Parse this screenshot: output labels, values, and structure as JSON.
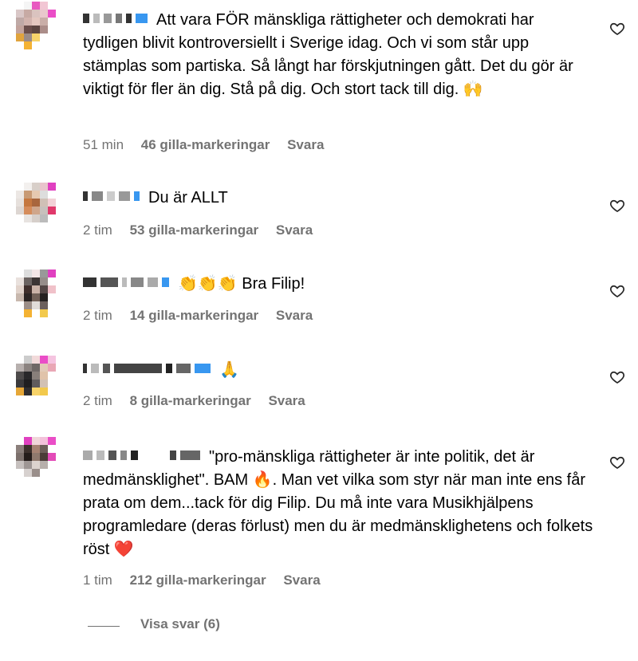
{
  "comments": [
    {
      "text": "Att vara FÖR mänskliga rättigheter och demokrati har tydligen blivit kontroversiellt i Sverige idag. Och vi som står upp stämplas som partiska. Så långt har förskjutningen gått. Det du gör är viktigt för fler än dig. Stå på dig. Och stort tack till dig. 🙌",
      "time": "51 min",
      "likes": "46 gilla-markeringar",
      "reply": "Svara"
    },
    {
      "text": "Du är ALLT",
      "time": "2 tim",
      "likes": "53 gilla-markeringar",
      "reply": "Svara"
    },
    {
      "text": "👏👏👏 Bra Filip!",
      "time": "2 tim",
      "likes": "14 gilla-markeringar",
      "reply": "Svara"
    },
    {
      "text": "🙏",
      "time": "2 tim",
      "likes": "8 gilla-markeringar",
      "reply": "Svara"
    },
    {
      "text": "\"pro-mänskliga rättigheter är inte politik, det är medmänsklighet\". BAM 🔥. Man vet vilka som styr när man inte ens får prata om dem...tack för dig Filip. Du må inte vara Musikhjälpens programledare (deras förlust) men du är medmänsklighetens och folkets röst ❤️",
      "time": "1 tim",
      "likes": "212 gilla-markeringar",
      "reply": "Svara"
    }
  ],
  "view_replies": "Visa svar (6)",
  "icons": {
    "like": "heart-outline-icon"
  },
  "colors": {
    "meta": "#737373",
    "verified_blue": "#3897f0"
  }
}
